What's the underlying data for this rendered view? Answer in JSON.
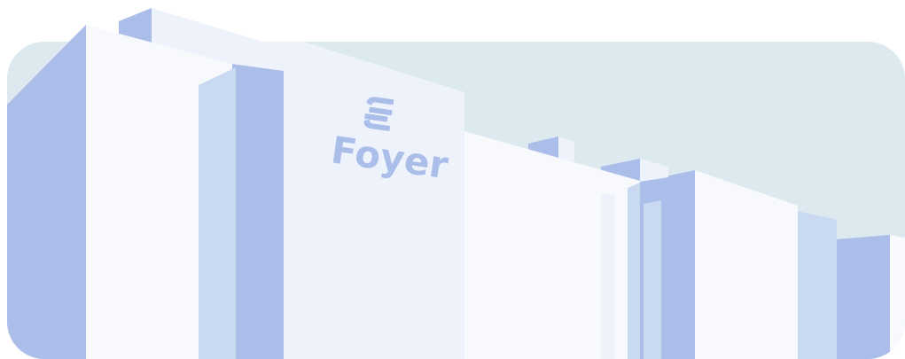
{
  "brand": {
    "name": "Foyer",
    "logo_icon": "foyer-logo-icon"
  },
  "colors": {
    "sky": "#dce9ef",
    "building_shadow": "#abbde9",
    "building_light": "#f7f9fd",
    "building_mid": "#eef3fb",
    "building_accent": "#c9daf0",
    "background": "#ffffff"
  }
}
